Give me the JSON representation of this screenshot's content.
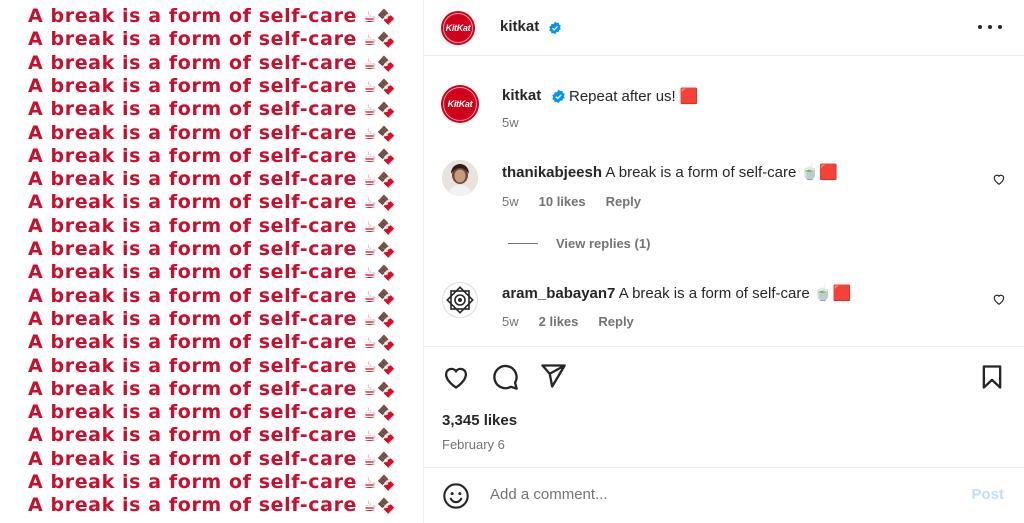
{
  "post_image": {
    "line_text": "A break is a form of self-care",
    "line_emoji": "☕🍫",
    "line_count": 22
  },
  "header": {
    "avatar_text": "KitKat",
    "username": "kitkat",
    "more_icon": "more-horizontal-icon"
  },
  "caption": {
    "avatar_text": "KitKat",
    "username": "kitkat",
    "text": "Repeat after us! 🟥",
    "time": "5w"
  },
  "comments": [
    {
      "username": "thanikabjeesh",
      "text": "A break is a form of self-care 🍵🟥",
      "time": "5w",
      "likes": "10 likes",
      "reply": "Reply",
      "view_replies": "View replies (1)"
    },
    {
      "username": "aram_babayan7",
      "text": "A break is a form of self-care 🍵🟥",
      "time": "5w",
      "likes": "2 likes",
      "reply": "Reply"
    }
  ],
  "actions": {
    "like_icon": "heart-icon",
    "comment_icon": "comment-icon",
    "share_icon": "share-icon",
    "save_icon": "bookmark-icon"
  },
  "likes": "3,345 likes",
  "date": "February 6",
  "add_comment": {
    "placeholder": "Add a comment...",
    "post_label": "Post"
  },
  "colors": {
    "brand_red": "#c8102e",
    "verified_blue": "#0095f6",
    "post_disabled": "#c0dffd"
  }
}
